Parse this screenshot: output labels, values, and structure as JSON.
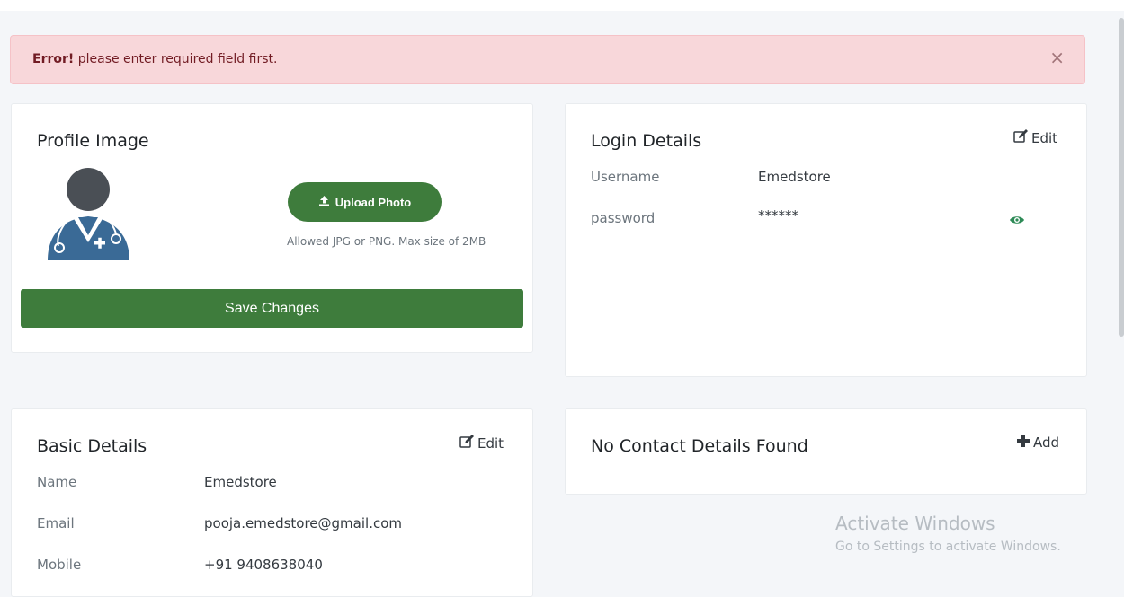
{
  "alert": {
    "strong": "Error!",
    "message": " please enter required field first.",
    "close_label": "×"
  },
  "profile_image": {
    "title": "Profile Image",
    "avatar_icon": "doctor-avatar-icon",
    "upload_label": "Upload Photo",
    "upload_icon": "upload-icon",
    "hint": "Allowed JPG or PNG. Max size of 2MB",
    "save_label": "Save Changes"
  },
  "login_details": {
    "title": "Login Details",
    "edit_label": "Edit",
    "rows": [
      {
        "label": "Username",
        "value": "Emedstore"
      },
      {
        "label": "password",
        "value": "******"
      }
    ],
    "reveal_icon": "eye-icon"
  },
  "basic_details": {
    "title": "Basic Details",
    "edit_label": "Edit",
    "rows": [
      {
        "label": "Name",
        "value": "Emedstore"
      },
      {
        "label": "Email",
        "value": "pooja.emedstore@gmail.com"
      },
      {
        "label": "Mobile",
        "value": "+91 9408638040"
      }
    ]
  },
  "contact_details": {
    "title": "No Contact Details Found",
    "add_label": "Add",
    "add_icon": "plus-icon"
  },
  "watermark": {
    "line1": "Activate Windows",
    "line2": "Go to Settings to activate Windows."
  },
  "colors": {
    "primary_green": "#3e7c3c",
    "alert_bg": "#f8d7da",
    "avatar_blue": "#3a6a96",
    "avatar_head": "#4a4f55",
    "eye_green": "#2e8b57"
  }
}
